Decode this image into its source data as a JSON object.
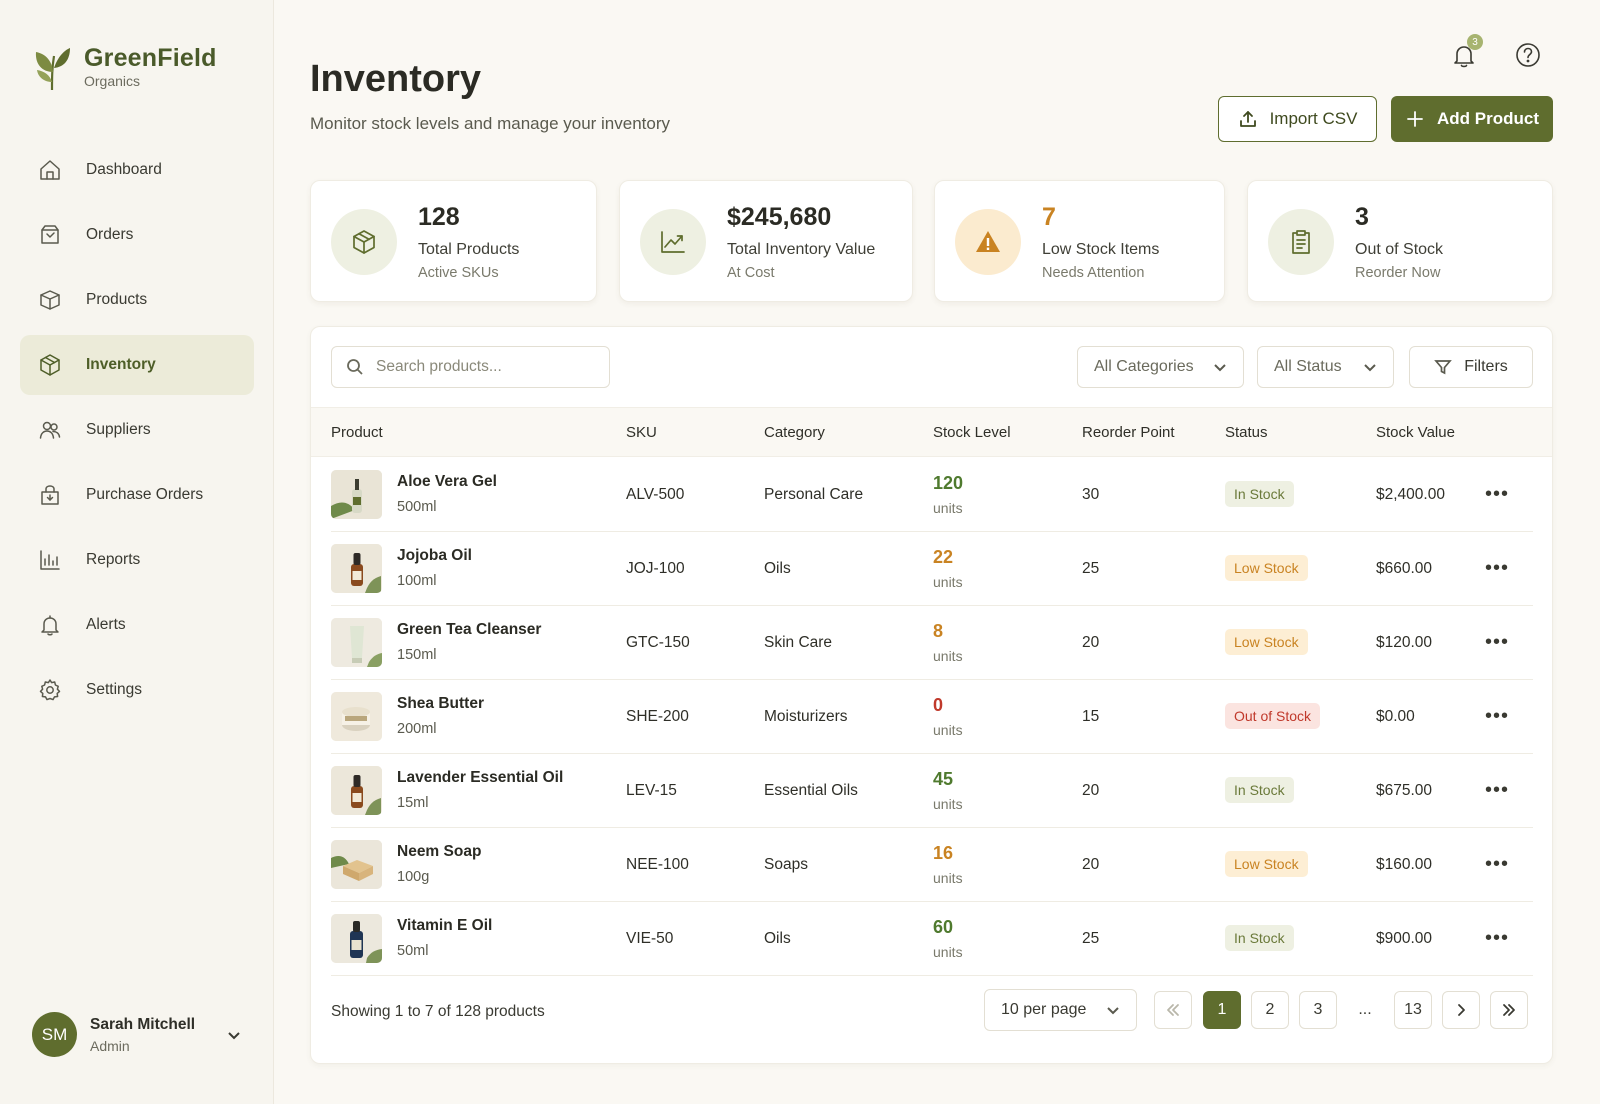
{
  "brand": {
    "name": "GreenField",
    "sub": "Organics"
  },
  "nav": [
    {
      "label": "Dashboard",
      "icon": "home-icon",
      "active": false
    },
    {
      "label": "Orders",
      "icon": "orders-icon",
      "active": false
    },
    {
      "label": "Products",
      "icon": "box-icon",
      "active": false
    },
    {
      "label": "Inventory",
      "icon": "cube-icon",
      "active": true
    },
    {
      "label": "Suppliers",
      "icon": "users-icon",
      "active": false
    },
    {
      "label": "Purchase Orders",
      "icon": "purchase-icon",
      "active": false
    },
    {
      "label": "Reports",
      "icon": "chart-icon",
      "active": false
    },
    {
      "label": "Alerts",
      "icon": "bell-icon",
      "active": false
    },
    {
      "label": "Settings",
      "icon": "gear-icon",
      "active": false
    }
  ],
  "user": {
    "initials": "SM",
    "name": "Sarah Mitchell",
    "role": "Admin"
  },
  "header": {
    "title": "Inventory",
    "subtitle": "Monitor stock levels and manage your inventory",
    "notification_count": "3",
    "import_label": "Import CSV",
    "add_label": "Add Product"
  },
  "stats": [
    {
      "value": "128",
      "label": "Total Products",
      "sub": "Active SKUs",
      "icon": "cube-icon"
    },
    {
      "value": "$245,680",
      "label": "Total Inventory Value",
      "sub": "At Cost",
      "icon": "trend-up-icon"
    },
    {
      "value": "7",
      "label": "Low Stock Items",
      "sub": "Needs Attention",
      "icon": "warning-icon"
    },
    {
      "value": "3",
      "label": "Out of Stock",
      "sub": "Reorder Now",
      "icon": "clipboard-icon"
    }
  ],
  "toolbar": {
    "search_placeholder": "Search products...",
    "category_select": "All Categories",
    "status_select": "All Status",
    "filters_label": "Filters"
  },
  "table": {
    "columns": [
      "Product",
      "SKU",
      "Category",
      "Stock Level",
      "Reorder Point",
      "Status",
      "Stock Value"
    ],
    "rows": [
      {
        "name": "Aloe Vera Gel",
        "size": "500ml",
        "sku": "ALV-500",
        "category": "Personal Care",
        "stock": "120",
        "unit": "units",
        "reorder": "30",
        "status": "In Stock",
        "value": "$2,400.00",
        "thumb": "gel-bottle"
      },
      {
        "name": "Jojoba Oil",
        "size": "100ml",
        "sku": "JOJ-100",
        "category": "Oils",
        "stock": "22",
        "unit": "units",
        "reorder": "25",
        "status": "Low Stock",
        "value": "$660.00",
        "thumb": "amber-dropper"
      },
      {
        "name": "Green Tea Cleanser",
        "size": "150ml",
        "sku": "GTC-150",
        "category": "Skin Care",
        "stock": "8",
        "unit": "units",
        "reorder": "20",
        "status": "Low Stock",
        "value": "$120.00",
        "thumb": "tube"
      },
      {
        "name": "Shea Butter",
        "size": "200ml",
        "sku": "SHE-200",
        "category": "Moisturizers",
        "stock": "0",
        "unit": "units",
        "reorder": "15",
        "status": "Out of Stock",
        "value": "$0.00",
        "thumb": "jar"
      },
      {
        "name": "Lavender Essential Oil",
        "size": "15ml",
        "sku": "LEV-15",
        "category": "Essential Oils",
        "stock": "45",
        "unit": "units",
        "reorder": "20",
        "status": "In Stock",
        "value": "$675.00",
        "thumb": "amber-dropper"
      },
      {
        "name": "Neem Soap",
        "size": "100g",
        "sku": "NEE-100",
        "category": "Soaps",
        "stock": "16",
        "unit": "units",
        "reorder": "20",
        "status": "Low Stock",
        "value": "$160.00",
        "thumb": "soap"
      },
      {
        "name": "Vitamin E Oil",
        "size": "50ml",
        "sku": "VIE-50",
        "category": "Oils",
        "stock": "60",
        "unit": "units",
        "reorder": "25",
        "status": "In Stock",
        "value": "$900.00",
        "thumb": "blue-bottle"
      }
    ]
  },
  "pagination": {
    "showing": "Showing 1 to 7 of 128 products",
    "per_page": "10 per page",
    "pages": [
      "1",
      "2",
      "3",
      "...",
      "13"
    ],
    "current": "1"
  },
  "colors": {
    "accent": "#5f6d2e",
    "in_stock_text": "#6b7a3a",
    "in_stock_bg": "#eef0e2",
    "low_stock_text": "#c98322",
    "low_stock_bg": "#fdeed4",
    "out_stock_text": "#c0392b",
    "out_stock_bg": "#fbe4e0"
  }
}
